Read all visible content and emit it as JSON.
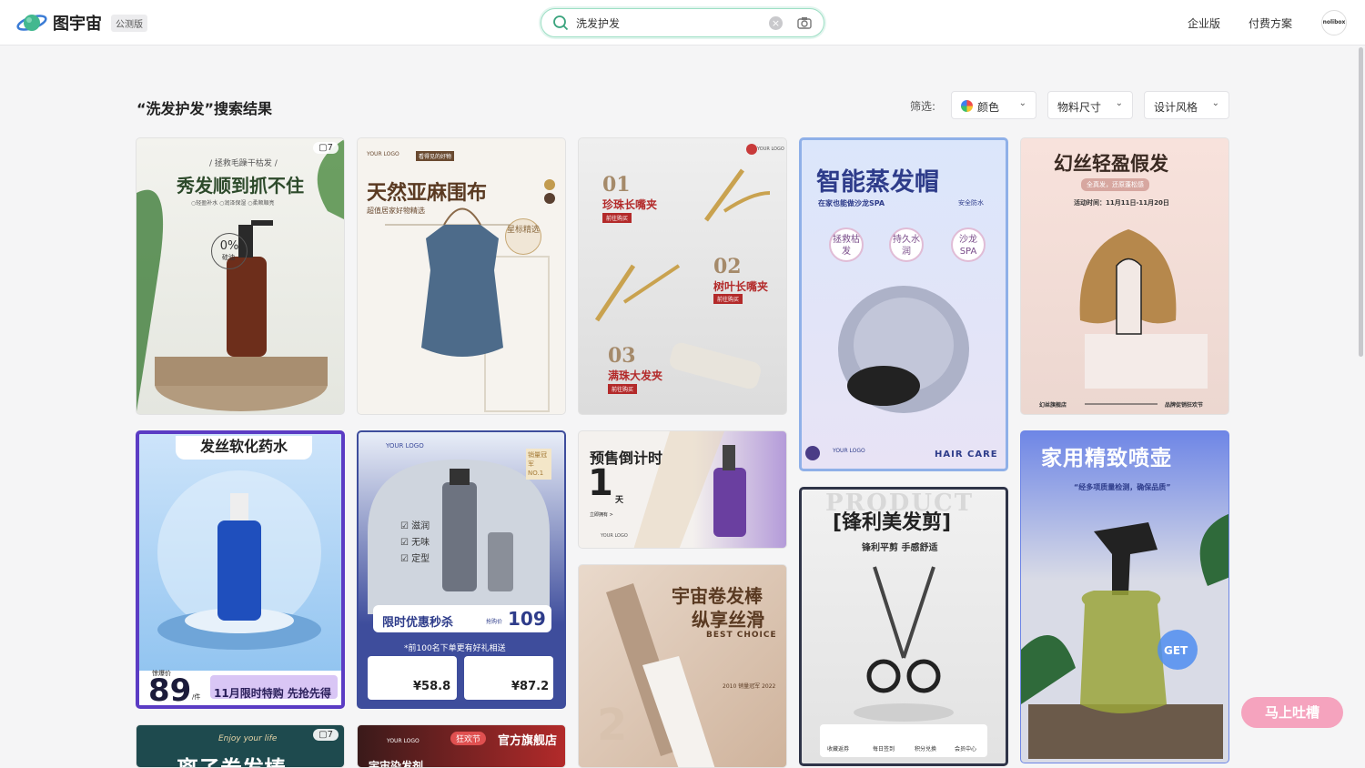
{
  "brand": {
    "name": "图宇宙",
    "badge": "公测版"
  },
  "search": {
    "query": "洗发护发"
  },
  "nav": {
    "enterprise": "企业版",
    "pricing": "付费方案",
    "avatar": "nolibox"
  },
  "results_title": "“洗发护发”搜索结果",
  "filters": {
    "label": "筛选:",
    "color": "颜色",
    "size": "物料尺寸",
    "style": "设计风格"
  },
  "cards": [
    {
      "title": "秀发顺到抓不住",
      "sub": "/ 拯救毛躁干枯发 /",
      "tags": "○轻盈补水   ○润泽保湿   ○柔顺順亮",
      "count": "7",
      "badge": "0%",
      "badge_sub": "硅油"
    },
    {
      "title": "天然亚麻围布",
      "sub": "超值居家好物精选",
      "logo": "YOUR LOGO",
      "stamp": "星标精选",
      "tag": "看得见的好物"
    },
    {
      "n1": "01",
      "l1": "珍珠长嘴夹",
      "n2": "02",
      "l2": "树叶长嘴夹",
      "n3": "03",
      "l3": "满珠大发夹",
      "btn": "前往购买",
      "logo": "YOUR LOGO"
    },
    {
      "title": "智能蒸发帽",
      "sub": "在家也能做沙龙SPA",
      "tag": "安全防水",
      "c1": "拯救枯发",
      "c2": "持久水润",
      "c3": "沙龙SPA",
      "logo": "YOUR LOGO",
      "foot": "HAIR CARE"
    },
    {
      "title": "幻丝轻盈假发",
      "sub": "全真发，还原蓬松感",
      "date": "活动时间：11月11日-11月20日",
      "foot_l": "幻丝旗舰店",
      "foot_r": "品牌促销狂欢节"
    },
    {
      "title": "发丝软化药水",
      "price_label": "惊爆价",
      "price": "89",
      "unit": "/件",
      "promo": "11月限时特购 先抢先得"
    },
    {
      "logo": "YOUR LOGO",
      "rank": "销量冠军NO.1",
      "f1": "滋润",
      "f2": "无味",
      "f3": "定型",
      "promo": "限时优惠秒杀",
      "price_label": "抢购价",
      "price": "109",
      "note": "*前100名下单更有好礼相送",
      "p1": "¥58.8",
      "p2": "¥87.2"
    },
    {
      "title": "预售倒计时",
      "num": "1",
      "unit": "天",
      "btn": "立即拥有 >",
      "logo": "YOUR LOGO"
    },
    {
      "title": "[锋利美发剪]",
      "bg": "PRODUCT",
      "sub": "锋利平剪 手感舒适",
      "i1": "收藏返券",
      "i2": "每日签到",
      "i3": "积分兑换",
      "i4": "会员中心"
    },
    {
      "title": "家用精致喷壶",
      "sub": "“经多项质量检测，确保品质”",
      "cta": "GET"
    },
    {
      "title": "宇宙卷发棒",
      "title2": "纵享丝滑",
      "sub": "BEST CHOICE",
      "years": "2010  销量冠军  2022",
      "big": "2"
    },
    {
      "title": "离子卷发棒",
      "sub": "Enjoy your life",
      "count": "7"
    },
    {
      "logo": "YOUR LOGO",
      "tag": "狂欢节",
      "store": "官方旗舰店",
      "title": "宇宙染发剂"
    }
  ],
  "feedback": "马上吐槽"
}
